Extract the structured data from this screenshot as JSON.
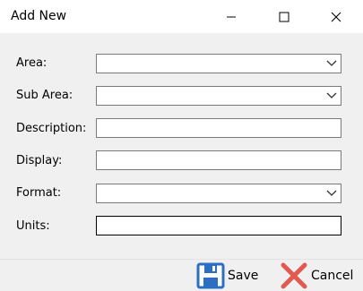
{
  "window": {
    "title": "Add New"
  },
  "fields": [
    {
      "label": "Area:",
      "value": ""
    },
    {
      "label": "Sub Area:",
      "value": ""
    },
    {
      "label": "Description:",
      "value": ""
    },
    {
      "label": "Display:",
      "value": ""
    },
    {
      "label": "Format:",
      "value": ""
    },
    {
      "label": "Units:",
      "value": ""
    }
  ],
  "buttons": {
    "save": "Save",
    "cancel": "Cancel"
  },
  "icons": {
    "save": "floppy-disk-icon",
    "cancel": "red-x-icon",
    "minimize": "minimize-icon",
    "maximize": "maximize-icon",
    "close": "close-icon",
    "dropdown": "chevron-down-icon"
  },
  "colors": {
    "save_icon": "#2c6fc2",
    "cancel_icon": "#e05a4f"
  }
}
